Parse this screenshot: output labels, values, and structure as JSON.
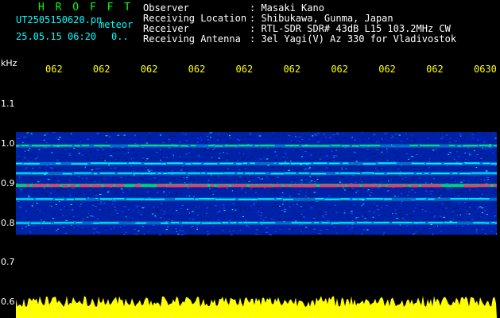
{
  "header": {
    "app_title": "H R O F F T",
    "filename": "UT2505150620.pn",
    "mode": "meteor",
    "datetime": "25.05.15 06:20",
    "count": "0..",
    "info": [
      {
        "label": "Observer",
        "value": ": Masaki Kano"
      },
      {
        "label": "Receiving Location",
        "value": ": Shibukawa, Gunma, Japan"
      },
      {
        "label": "Receiver",
        "value": ": RTL-SDR SDR# 43dB L15 103.2MHz CW"
      },
      {
        "label": "Receiving Antenna",
        "value": ": 3el Yagi(V) Az 330 for Vladivostok"
      }
    ]
  },
  "colors": {
    "background": "#000000",
    "title": "#00ff00",
    "meta": "#00ffff",
    "info_text": "#ffffff",
    "time_ticks": "#ffff00",
    "signal_peak": "#ff3366",
    "signal_high": "#00ff66",
    "signal_mid": "#00ffff",
    "noise_floor": "#0022aa",
    "amplitude_trace": "#ffff00"
  },
  "chart_data": {
    "type": "heatmap",
    "ylabel": "kHz",
    "yticks": [
      "1.1",
      "1.0",
      "0.9",
      "0.8",
      "0.7",
      "0.6"
    ],
    "xticks": [
      "062",
      "062",
      "062",
      "062",
      "062",
      "062",
      "062",
      "062",
      "062",
      "0630"
    ],
    "ylim": [
      0.6,
      1.15
    ],
    "signal_lines_khz": [
      {
        "freq": 0.895,
        "strength": "peak"
      },
      {
        "freq": 0.995,
        "strength": "high"
      },
      {
        "freq": 0.86,
        "strength": "mid"
      },
      {
        "freq": 0.8,
        "strength": "mid"
      },
      {
        "freq": 0.95,
        "strength": "mid"
      },
      {
        "freq": 0.925,
        "strength": "mid"
      }
    ],
    "noise_band_khz": [
      0.77,
      1.03
    ],
    "amplitude_trace": "bottom"
  }
}
